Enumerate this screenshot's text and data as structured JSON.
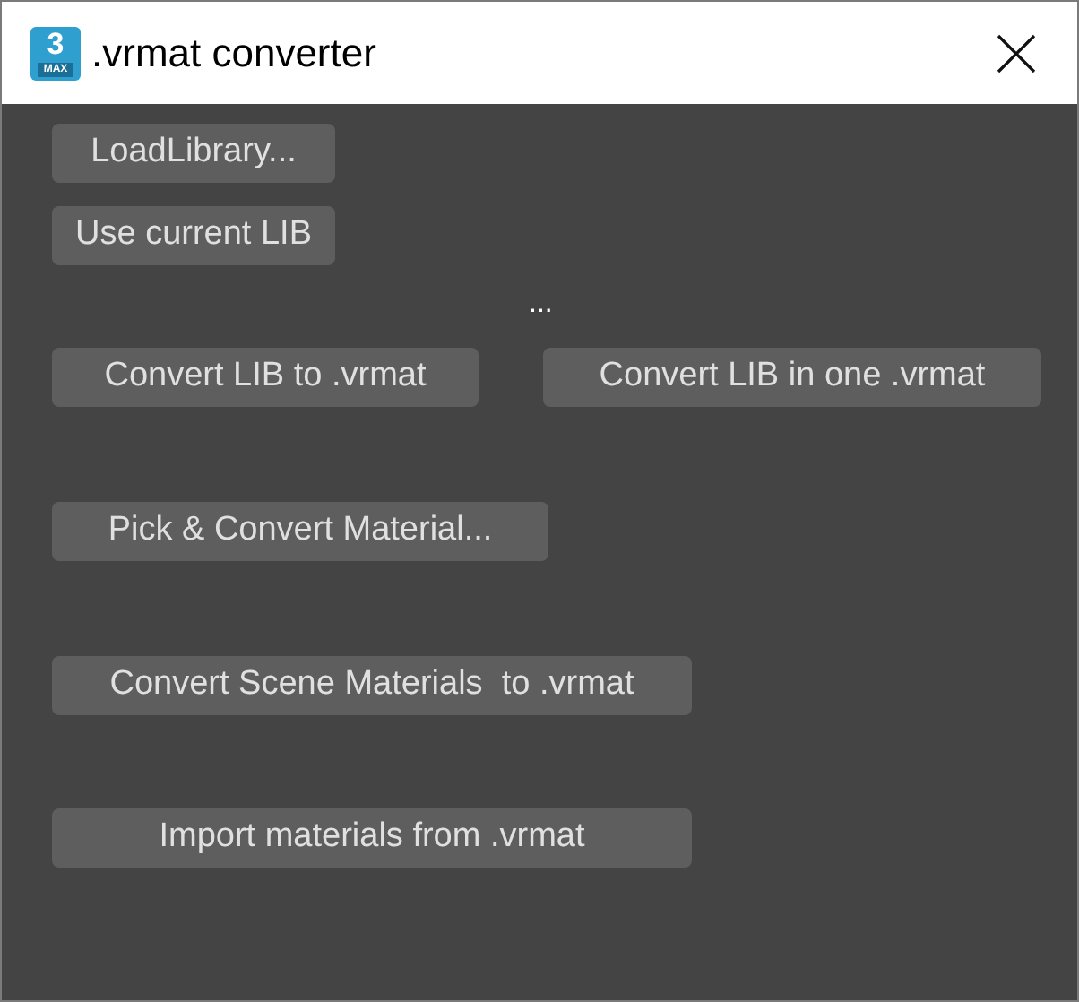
{
  "window": {
    "title": ".vrmat converter",
    "app_icon_text": "3",
    "app_icon_label": "MAX"
  },
  "rows": [
    {
      "items": [
        {
          "kind": "button",
          "label": "LoadLibrary..."
        }
      ]
    },
    {
      "items": [
        {
          "kind": "button",
          "label": "Use current LIB"
        }
      ]
    },
    {
      "items": [
        {
          "kind": "label",
          "label": "..."
        }
      ]
    },
    {
      "items": [
        {
          "kind": "button",
          "label": "Convert LIB to .vrmat"
        },
        {
          "kind": "button",
          "label": "Convert LIB in one .vrmat"
        }
      ]
    },
    {
      "items": [
        {
          "kind": "button",
          "label": "Pick & Convert Material..."
        }
      ]
    },
    {
      "items": [
        {
          "kind": "button",
          "label": "Convert Scene Materials  to .vrmat"
        }
      ]
    },
    {
      "items": [
        {
          "kind": "button",
          "label": "Import materials from .vrmat"
        }
      ]
    }
  ]
}
